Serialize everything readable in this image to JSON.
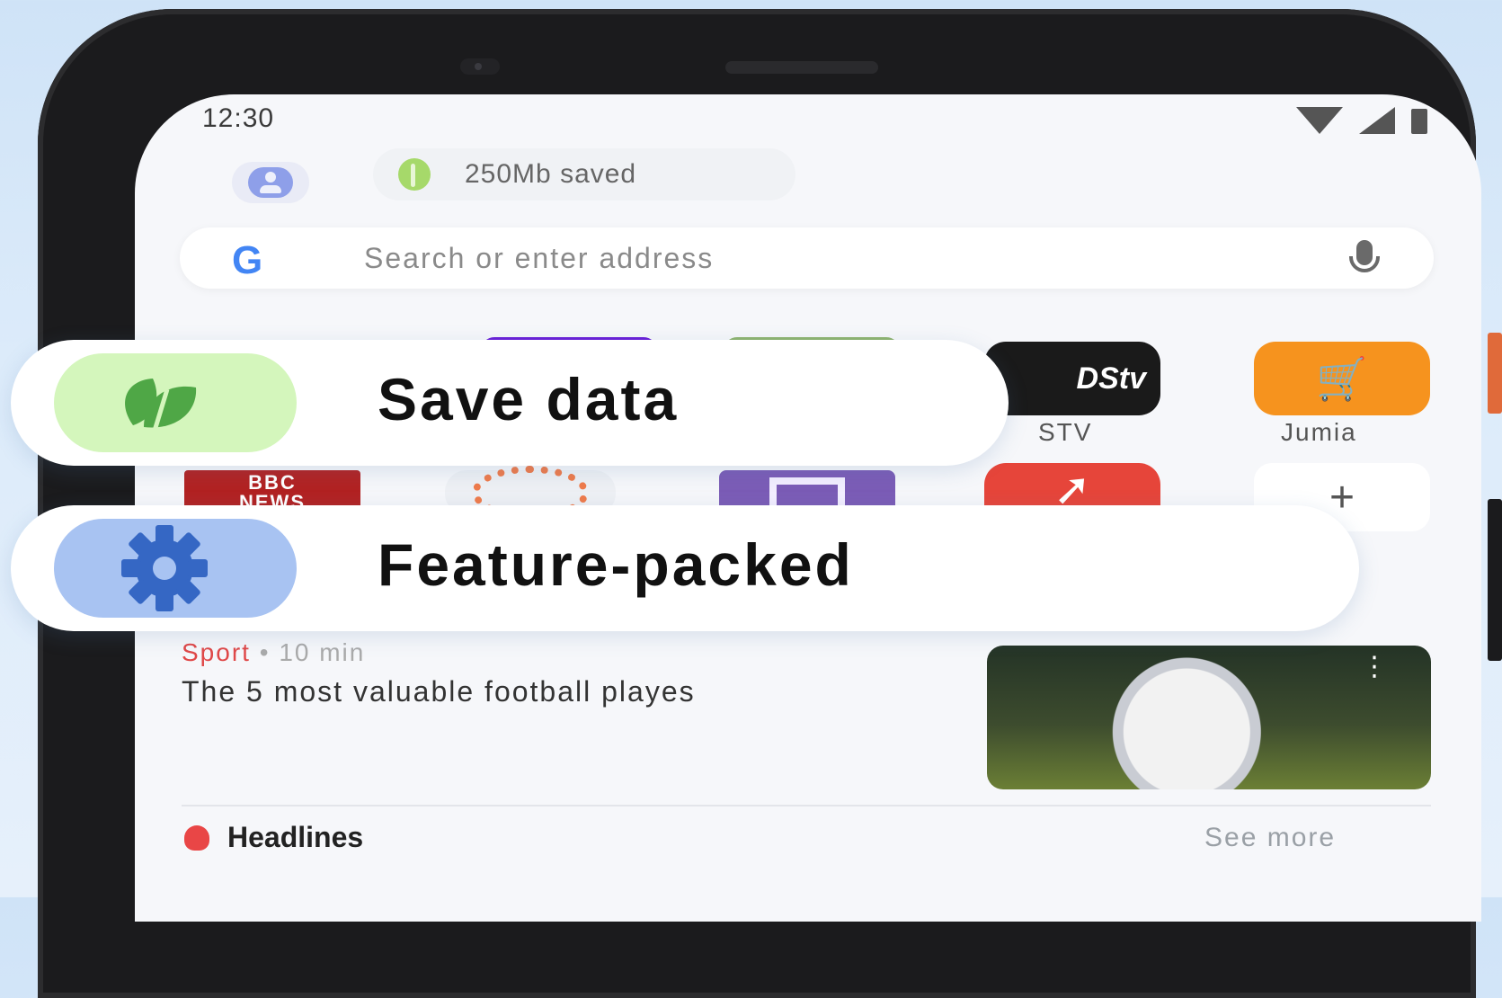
{
  "status_bar": {
    "time": "12:30"
  },
  "header": {
    "data_saved": "250Mb saved"
  },
  "search": {
    "placeholder": "Search or enter address",
    "engine_logo": "G"
  },
  "speed_dial": {
    "row1": [
      {
        "label": "DStv",
        "partial_label": "STV",
        "icon": "dstv-logo"
      },
      {
        "label": "Jumia",
        "icon": "shopping-cart-star-icon"
      }
    ],
    "row2": [
      {
        "label": "BBC NEWS",
        "logo_lines": [
          "BBC",
          "NEWS"
        ]
      },
      {
        "label": "",
        "icon": "dotted-ring-logo"
      },
      {
        "label": "",
        "icon": "twitch-icon"
      },
      {
        "label": "",
        "icon": "trending-arrow-icon"
      },
      {
        "label": "+",
        "icon": "add-icon"
      }
    ]
  },
  "callouts": [
    {
      "text": "Save data",
      "icon": "leaf-icon",
      "color": "#d4f6bc"
    },
    {
      "text": "Feature-packed",
      "icon": "gear-icon",
      "color": "#a8c3f2"
    }
  ],
  "news_card": {
    "category": "Sport",
    "separator": "•",
    "time": "10 min",
    "title": "The 5 most valuable football playes",
    "menu": "⋮"
  },
  "headlines": {
    "title": "Headlines",
    "see_more": "See more"
  }
}
